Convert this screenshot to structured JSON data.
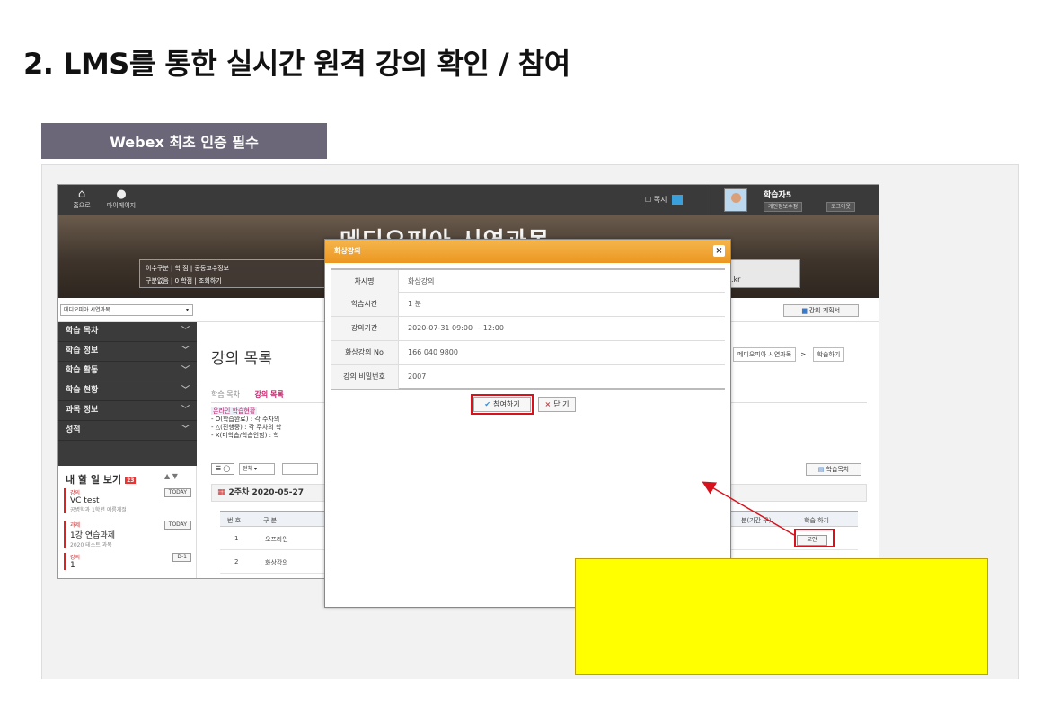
{
  "slide": {
    "title": "2. LMS를 통한 실시간 원격 강의 확인 / 참여",
    "section_tab": "Webex 최초 인증 필수"
  },
  "topbar": {
    "home_label": "홈으로",
    "mypage_label": "마이페이지",
    "notice_label": "쪽지",
    "user_name": "학습자5",
    "edit_info_label": "개인정보수정",
    "logout_label": "로그아웃"
  },
  "banner": {
    "title": "메디오피아 시연과목",
    "info_row1": "이수구분  |  학 점  |  공동교수정보",
    "info_row2": "구분없음  |  0 학점  |  조회하기",
    "right_info": ".kr"
  },
  "course_bar": {
    "selected_course": "메디오피아 시연과목",
    "plan_button": "강의 계획서"
  },
  "sidebar": {
    "items": [
      {
        "label": "학습 목차"
      },
      {
        "label": "학습 정보"
      },
      {
        "label": "학습 활동"
      },
      {
        "label": "학습 현황"
      },
      {
        "label": "과목 정보"
      },
      {
        "label": "성적"
      }
    ]
  },
  "todo": {
    "title": "내 할 일 보기",
    "badge": "23",
    "tasks": [
      {
        "category": "강의",
        "title": "VC test",
        "sub": "공병학과 1학년 여름계절",
        "tag": "TODAY"
      },
      {
        "category": "과제",
        "title": "1강 연습과제",
        "sub": "2020 테스트 과목",
        "tag": "TODAY"
      },
      {
        "category": "강의",
        "title": "1",
        "sub": "",
        "tag": "D-1"
      }
    ]
  },
  "content": {
    "page_title": "강의 목록",
    "breadcrumb_course": "메디오피아 시연과목",
    "breadcrumb_sep": ">",
    "breadcrumb_current": "학습하기",
    "tab_inactive": "학습 목차",
    "tab_active": "강의 목록",
    "legend_head": "온라인 학습현황",
    "legend_lines": [
      "- O(학습완료) : 각 주차의",
      "- △(진행중) : 각 주차의 학",
      "- X(미학습/학습안함) : 학"
    ],
    "filter_select": "전체",
    "study_book_button": "학습목차",
    "week_label": "2주차  2020-05-27",
    "table": {
      "headers": [
        "번 호",
        "구 분",
        "분(기간 구)",
        "학습 하기"
      ],
      "rows": [
        {
          "no": "1",
          "type": "오프라인",
          "action": "교안"
        },
        {
          "no": "2",
          "type": "화상강의",
          "action": ""
        }
      ]
    }
  },
  "dialog": {
    "title": "화상강의",
    "rows": [
      {
        "label": "차시명",
        "value": "화상강의"
      },
      {
        "label": "학습시간",
        "value": "1 분"
      },
      {
        "label": "강의기간",
        "value": "2020-07-31 09:00 ~ 12:00"
      },
      {
        "label": "화상강의 No",
        "value": "166 040 9800"
      },
      {
        "label": "강의 비밀번호",
        "value": "2007"
      }
    ],
    "join_button": "참여하기",
    "close_button": "닫 기"
  },
  "colors": {
    "accent": "#ec9722",
    "highlight_red": "#d8121c",
    "note_yellow": "#ffff00",
    "tab_gray": "#6b6778"
  }
}
